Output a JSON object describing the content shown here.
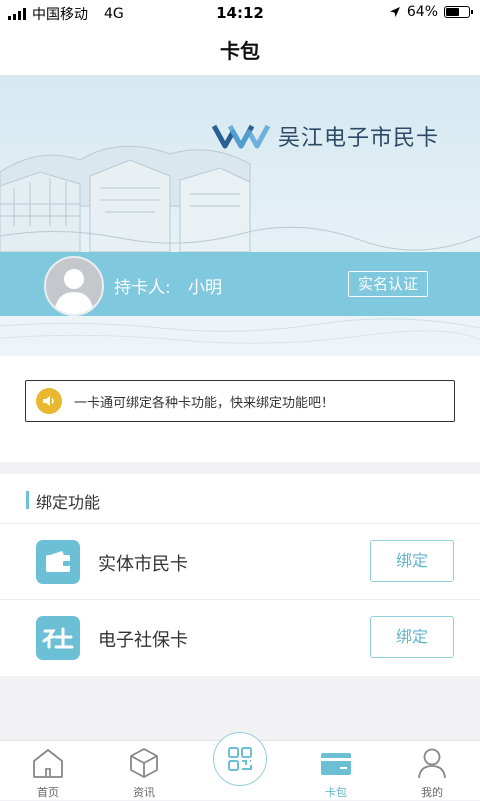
{
  "status_bar": {
    "carrier": "中国移动",
    "network": "4G",
    "time": "14:12",
    "battery": "64%",
    "battery_level": 0.64
  },
  "nav": {
    "title": "卡包"
  },
  "banner": {
    "brand": "吴江电子市民卡",
    "holder_label": "持卡人:",
    "holder_name": "小明",
    "verify_label": "实名认证"
  },
  "notice": {
    "text": "一卡通可绑定各种卡功能，快来绑定功能吧！"
  },
  "bind": {
    "title": "绑定功能",
    "items": [
      {
        "label": "实体市民卡",
        "button": "绑定",
        "icon": "wallet-icon"
      },
      {
        "label": "电子社保卡",
        "button": "绑定",
        "icon": "social-security-icon"
      }
    ]
  },
  "tabs": [
    {
      "label": "首页",
      "icon": "home-icon",
      "active": false
    },
    {
      "label": "资讯",
      "icon": "news-cube-icon",
      "active": false
    },
    {
      "label": "",
      "icon": "scan-qr-icon",
      "active": false
    },
    {
      "label": "卡包",
      "icon": "card-wallet-icon",
      "active": true
    },
    {
      "label": "我的",
      "icon": "person-icon",
      "active": false
    }
  ],
  "colors": {
    "accent": "#6cc0d6",
    "strip": "#76c4db",
    "notice_icon": "#e8b830",
    "brand": "#2f4a66"
  }
}
